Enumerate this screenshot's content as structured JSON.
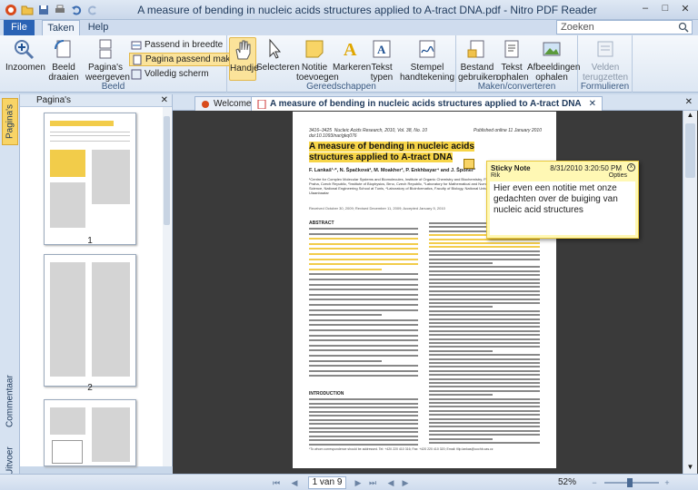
{
  "window": {
    "title": "A measure of bending in nucleic acids structures applied to A-tract DNA.pdf - Nitro PDF Reader"
  },
  "tabs": {
    "file": "File",
    "home": "Taken",
    "help": "Help"
  },
  "search": {
    "placeholder": "Zoeken"
  },
  "ribbon": {
    "zoom_in": "Inzoomen",
    "rotate": "Beeld draaien",
    "page_views": "Pagina's weergeven",
    "fit_width": "Passend in breedte",
    "fit_page": "Pagina passend maken",
    "fullscreen": "Volledig scherm",
    "group_view": "Beeld",
    "hand": "Handje",
    "select": "Selecteren",
    "note_add": "Notitie toevoegen",
    "highlight": "Markeren",
    "text_type": "Tekst typen",
    "stamp_sign": "Stempel handtekening",
    "group_tools": "Gereedschappen",
    "file_use": "Bestand gebruiken",
    "text_extract": "Tekst ophalen",
    "images_extract": "Afbeeldingen ophalen",
    "group_convert": "Maken/converteren",
    "fields_reset": "Velden terugzetten",
    "group_forms": "Formulieren"
  },
  "side_tabs": {
    "pages": "Pagina's",
    "comments": "Commentaar",
    "output": "Uitvoer"
  },
  "pages_panel": {
    "title": "Pagina's",
    "thumbs": [
      {
        "num": "1"
      },
      {
        "num": "2"
      },
      {
        "num": ""
      }
    ]
  },
  "doc_tabs": {
    "welcome": "Welcome",
    "document": "A measure of bending in nucleic acids structures applied to A-tract DNA"
  },
  "document": {
    "journal": "3416–3425  Nucleic Acids Research, 2010, Vol. 38, No. 10\ndoi:10.1093/nar/gkq076",
    "published": "Published online 11 January 2010",
    "title": "A measure of bending in nucleic acids structures applied to A-tract DNA",
    "authors": "F. Lankaš¹·*, N. Špačková², M. Moakher³, P. Enkhbayar⁴ and J. Šponer²",
    "affiliation": "¹Centre for Complex Molecular Systems and Biomolecules, Institute of Organic Chemistry and Biochemistry, Flemingovo nám. 2, 166 10 Praha, Czech Republic, ²Institute of Biophysics, Brno, Czech Republic, ³Laboratory for Mathematical and Numerical Modelling in Engineering Science, National Engineering School at Tunis, ⁴Laboratory of Bioinformatics, Faculty of Biology, National University of Mongolia, Ulaanbaatar",
    "received": "Received October 30, 2009; Revised December 11, 2009; Accepted January 5, 2010",
    "abstract_title": "ABSTRACT",
    "intro_title": "INTRODUCTION",
    "footnote": "*To whom correspondence should be addressed. Tel: +420 220 410 316; Fax: +420 220 410 320; Email: filip.lankas@uochb.cas.cz"
  },
  "sticky": {
    "title": "Sticky Note",
    "date": "8/31/2010 3:20:50 PM",
    "author": "Rik",
    "options": "Opties",
    "body": "Hier even een notitie met onze gedachten over de buiging van nucleic acid structures"
  },
  "status": {
    "page": "1 van 9",
    "zoom": "52%"
  }
}
